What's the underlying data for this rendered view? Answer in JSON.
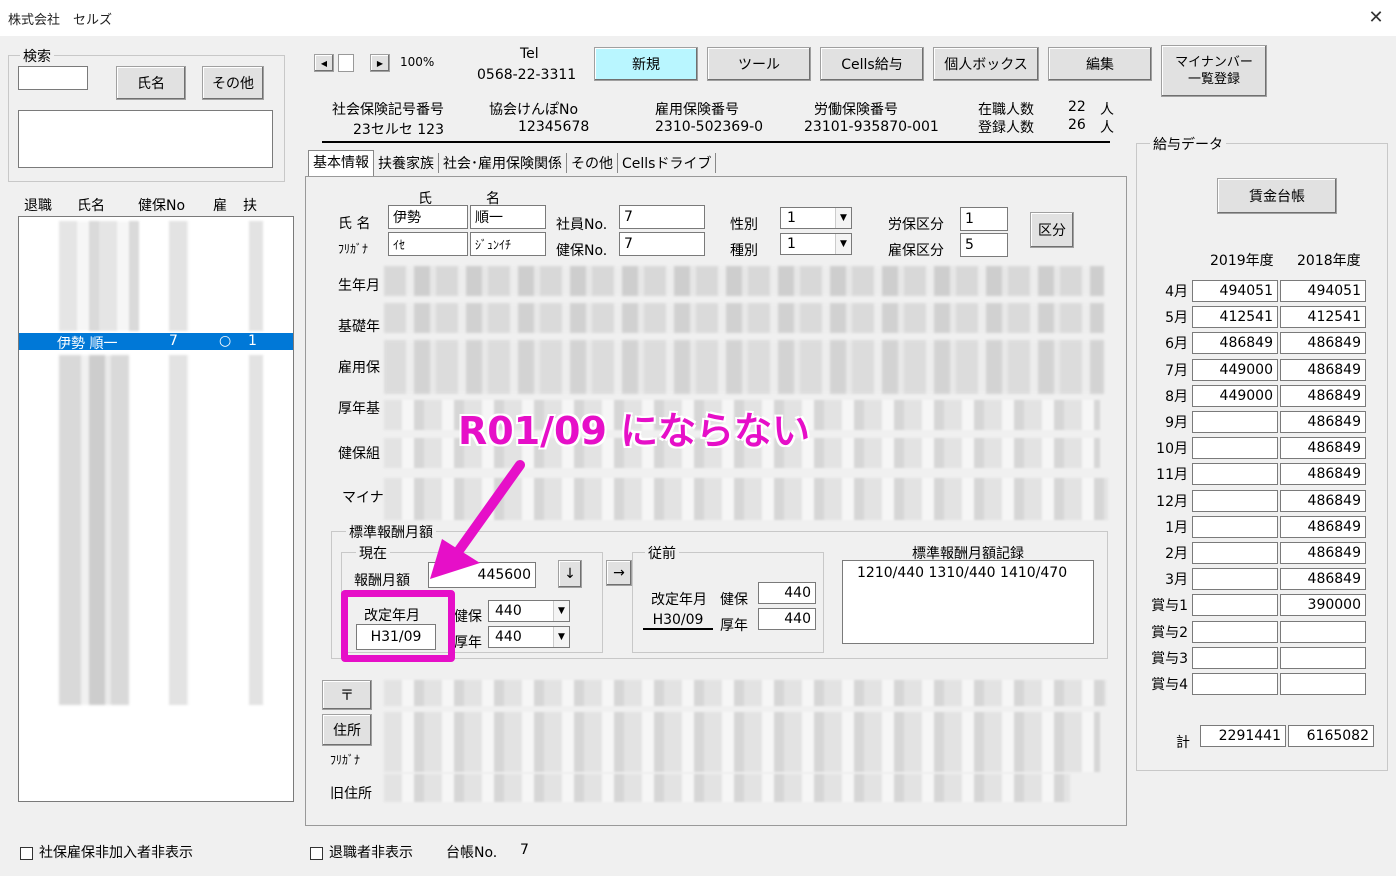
{
  "window": {
    "title": "株式会社　セルズ",
    "close": "✕"
  },
  "search": {
    "group_label": "検索",
    "name_button": "氏名",
    "other_button": "その他"
  },
  "emp_list": {
    "headers": [
      "退職",
      "氏名",
      "健保No",
      "雇",
      "扶"
    ],
    "selected": {
      "name": "伊勢 順一",
      "no": "7",
      "koyo": "○",
      "fuyo": "1"
    }
  },
  "toolbar": {
    "zoom": "100%",
    "tel_label": "Tel",
    "tel": "0568-22-3311",
    "buttons": {
      "new": "新規",
      "tool": "ツール",
      "cells_kyuyo": "Cells給与",
      "personal_box": "個人ボックス",
      "edit": "編集",
      "mynumber": "マイナンバー\n一覧登録"
    }
  },
  "office": {
    "shakai_label": "社会保険記号番号",
    "shakai": "23セルセ 123",
    "kyokai_label": "協会けんぽNo",
    "kyokai": "12345678",
    "koyo_label": "雇用保険番号",
    "koyo": "2310-502369-0",
    "rodo_label": "労働保険番号",
    "rodo": "23101-935870-001",
    "zaishoku_label": "在職人数",
    "zaishoku": "22",
    "toroku_label": "登録人数",
    "toroku": "26",
    "unit": "人"
  },
  "tabs": [
    "基本情報",
    "扶養家族",
    "社会･雇用保険関係",
    "その他",
    "Cellsドライブ"
  ],
  "basic": {
    "col_shi": "氏",
    "col_mei": "名",
    "name_label": "氏 名",
    "furigana_label": "ﾌﾘｶﾞﾅ",
    "last_name": "伊勢",
    "first_name": "順一",
    "last_kana": "ｲｾ",
    "first_kana": "ｼﾞｭﾝｲﾁ",
    "shain_label": "社員No.",
    "shain": "7",
    "kenpo_label": "健保No.",
    "kenpo": "7",
    "seibetsu_label": "性別",
    "seibetsu": "1",
    "shubetsu_label": "種別",
    "shubetsu": "1",
    "rouho_label": "労保区分",
    "rouho": "1",
    "koho_label": "雇保区分",
    "koho": "5",
    "kubun_button": "区分"
  },
  "fields": {
    "birth": "生年月",
    "kiso": "基礎年",
    "koyoho": "雇用保",
    "kosei": "厚年基",
    "kenpokumi": "健保組",
    "mynumber": "マイナン"
  },
  "standard": {
    "group": "標準報酬月額",
    "current": "現在",
    "houshu_label": "報酬月額",
    "houshu": "445600",
    "kaitei_label": "改定年月",
    "kaitei": "H31/09",
    "kenpo_label": "健保",
    "kenpo": "440",
    "kosei_label": "厚年",
    "kosei": "440",
    "down_arrow": "↓",
    "right_arrow": "→",
    "prev_group": "従前",
    "prev_kaitei_label": "改定年月",
    "prev_kaitei": "H30/09",
    "prev_kenpo_label": "健保",
    "prev_kenpo": "440",
    "prev_kosei_label": "厚年",
    "prev_kosei": "440",
    "record_label": "標準報酬月額記録",
    "record": "1210/440 1310/440 1410/470"
  },
  "address": {
    "zip_button": "〒",
    "addr_button": "住所",
    "furigana": "ﾌﾘｶﾞﾅ",
    "old": "旧住所"
  },
  "annotation": {
    "text": "R01/09 にならない",
    "color": "#e60fc8"
  },
  "salary": {
    "group": "給与データ",
    "ledger_button": "賃金台帳",
    "year1": "2019年度",
    "year2": "2018年度",
    "rows": [
      {
        "m": "4月",
        "a": "494051",
        "b": "494051"
      },
      {
        "m": "5月",
        "a": "412541",
        "b": "412541"
      },
      {
        "m": "6月",
        "a": "486849",
        "b": "486849"
      },
      {
        "m": "7月",
        "a": "449000",
        "b": "486849"
      },
      {
        "m": "8月",
        "a": "449000",
        "b": "486849"
      },
      {
        "m": "9月",
        "a": "",
        "b": "486849"
      },
      {
        "m": "10月",
        "a": "",
        "b": "486849"
      },
      {
        "m": "11月",
        "a": "",
        "b": "486849"
      },
      {
        "m": "12月",
        "a": "",
        "b": "486849"
      },
      {
        "m": "1月",
        "a": "",
        "b": "486849"
      },
      {
        "m": "2月",
        "a": "",
        "b": "486849"
      },
      {
        "m": "3月",
        "a": "",
        "b": "486849"
      },
      {
        "m": "賞与1",
        "a": "",
        "b": "390000"
      },
      {
        "m": "賞与2",
        "a": "",
        "b": ""
      },
      {
        "m": "賞与3",
        "a": "",
        "b": ""
      },
      {
        "m": "賞与4",
        "a": "",
        "b": ""
      }
    ],
    "total_label": "計",
    "total1": "2291441",
    "total2": "6165082"
  },
  "footer": {
    "hide_shaho": "社保雇保非加入者非表示",
    "hide_retired": "退職者非表示",
    "daicho_label": "台帳No.",
    "daicho": "7"
  }
}
